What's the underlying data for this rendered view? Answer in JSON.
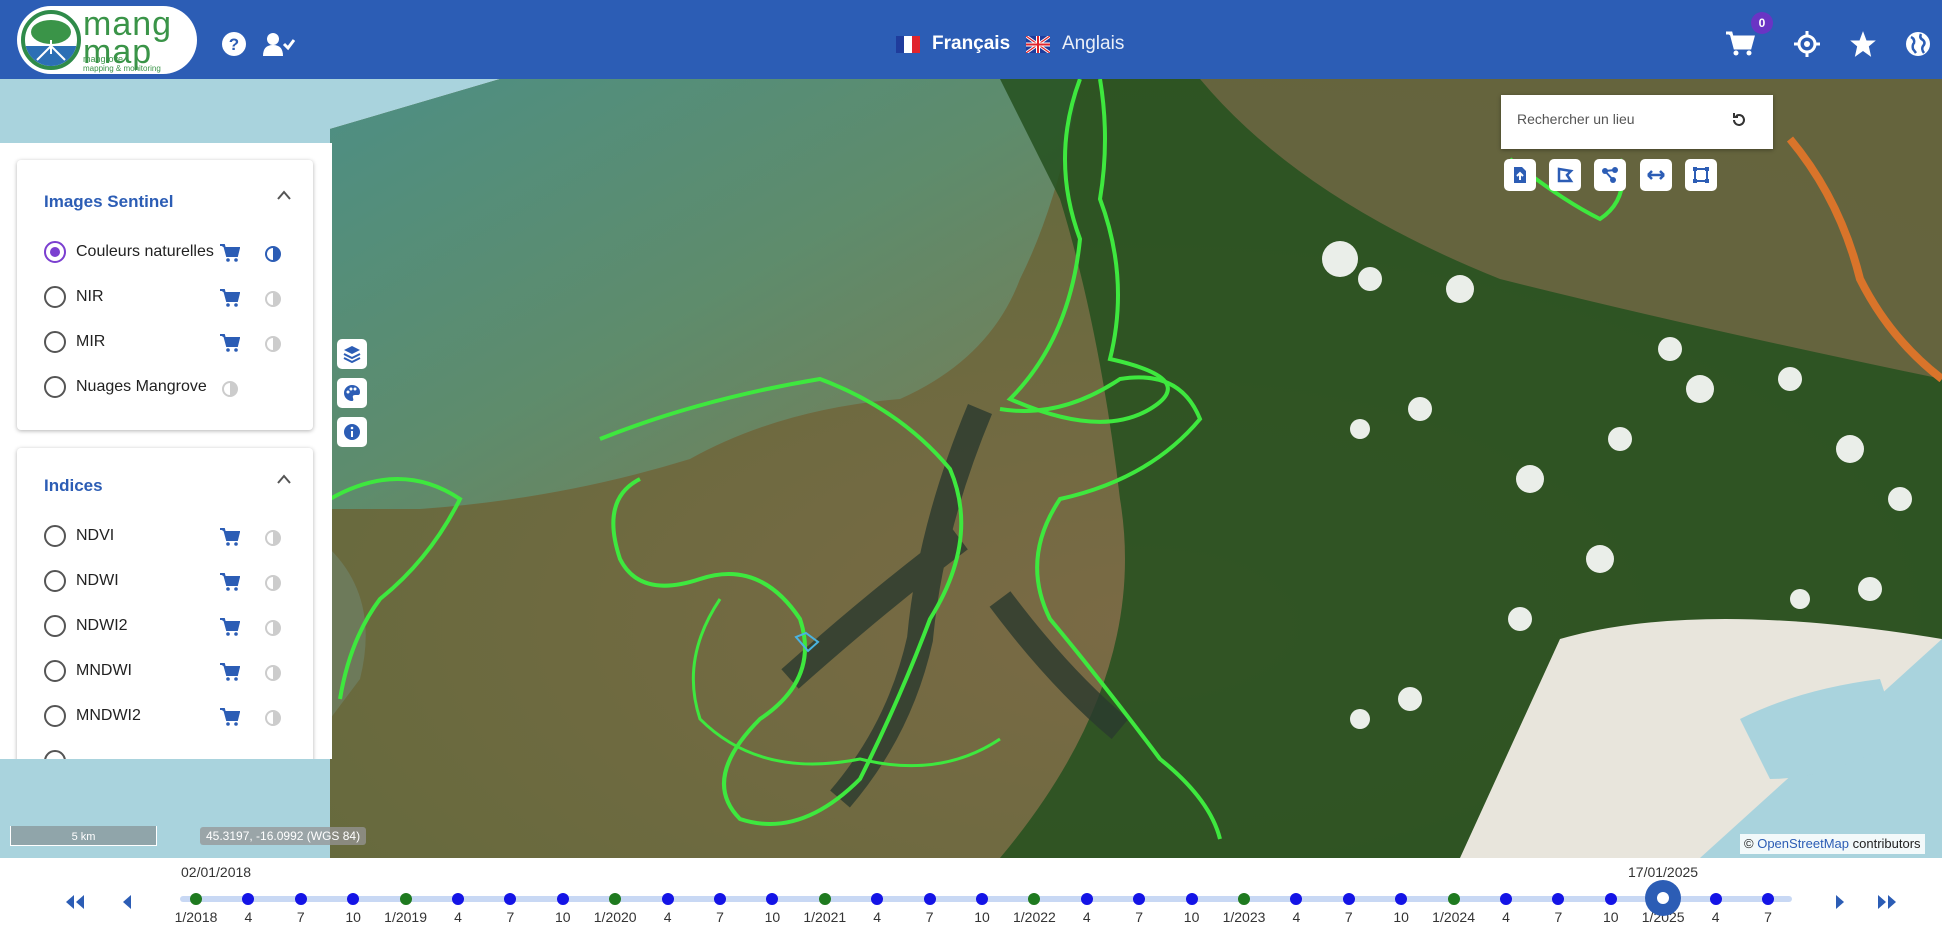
{
  "header": {
    "logo": {
      "title": "mang map",
      "subtitle_line1": "mangrove",
      "subtitle_line2": "mapping & monitoring"
    },
    "languages": [
      {
        "label": "Français",
        "active": true
      },
      {
        "label": "Anglais",
        "active": false
      }
    ],
    "cart_count": "0",
    "icons": [
      "help-icon",
      "user-check-icon",
      "cart-icon",
      "locate-icon",
      "star-icon",
      "globe-icon"
    ]
  },
  "sidebar": {
    "sections": [
      {
        "title": "Images Sentinel",
        "items": [
          {
            "label": "Couleurs naturelles",
            "selected": true,
            "cart": true,
            "contrast_active": true
          },
          {
            "label": "NIR",
            "selected": false,
            "cart": true,
            "contrast_active": false
          },
          {
            "label": "MIR",
            "selected": false,
            "cart": true,
            "contrast_active": false
          },
          {
            "label": "Nuages Mangrove",
            "selected": false,
            "cart": false,
            "contrast_active": false
          }
        ]
      },
      {
        "title": "Indices",
        "items": [
          {
            "label": "NDVI",
            "selected": false,
            "cart": true,
            "contrast_active": false
          },
          {
            "label": "NDWI",
            "selected": false,
            "cart": true,
            "contrast_active": false
          },
          {
            "label": "NDWI2",
            "selected": false,
            "cart": true,
            "contrast_active": false
          },
          {
            "label": "MNDWI",
            "selected": false,
            "cart": true,
            "contrast_active": false
          },
          {
            "label": "MNDWI2",
            "selected": false,
            "cart": true,
            "contrast_active": false
          }
        ]
      }
    ]
  },
  "map": {
    "search_placeholder": "Rechercher un lieu",
    "scale_label": "5 km",
    "coordinates": "45.3197, -16.0992 (WGS 84)",
    "attribution_prefix": "©",
    "attribution_link": "OpenStreetMap",
    "attribution_suffix": "contributors",
    "left_tools": [
      "layers-icon",
      "palette-icon",
      "info-icon"
    ],
    "draw_tools": [
      "upload-shape-icon",
      "draw-polygon-icon",
      "draw-network-icon",
      "measure-icon",
      "draw-rectangle-icon"
    ],
    "colors": {
      "mangrove_outline": "#3ee83e",
      "brand_blue": "#2c5db5"
    }
  },
  "timeline": {
    "start_date": "02/01/2018",
    "current_date": "17/01/2025",
    "ticks": [
      "1/2018",
      "4",
      "7",
      "10",
      "1/2019",
      "4",
      "7",
      "10",
      "1/2020",
      "4",
      "7",
      "10",
      "1/2021",
      "4",
      "7",
      "10",
      "1/2022",
      "4",
      "7",
      "10",
      "1/2023",
      "4",
      "7",
      "10",
      "1/2024",
      "4",
      "7",
      "10",
      "1/2025",
      "4",
      "7"
    ],
    "selected_index": 28
  }
}
